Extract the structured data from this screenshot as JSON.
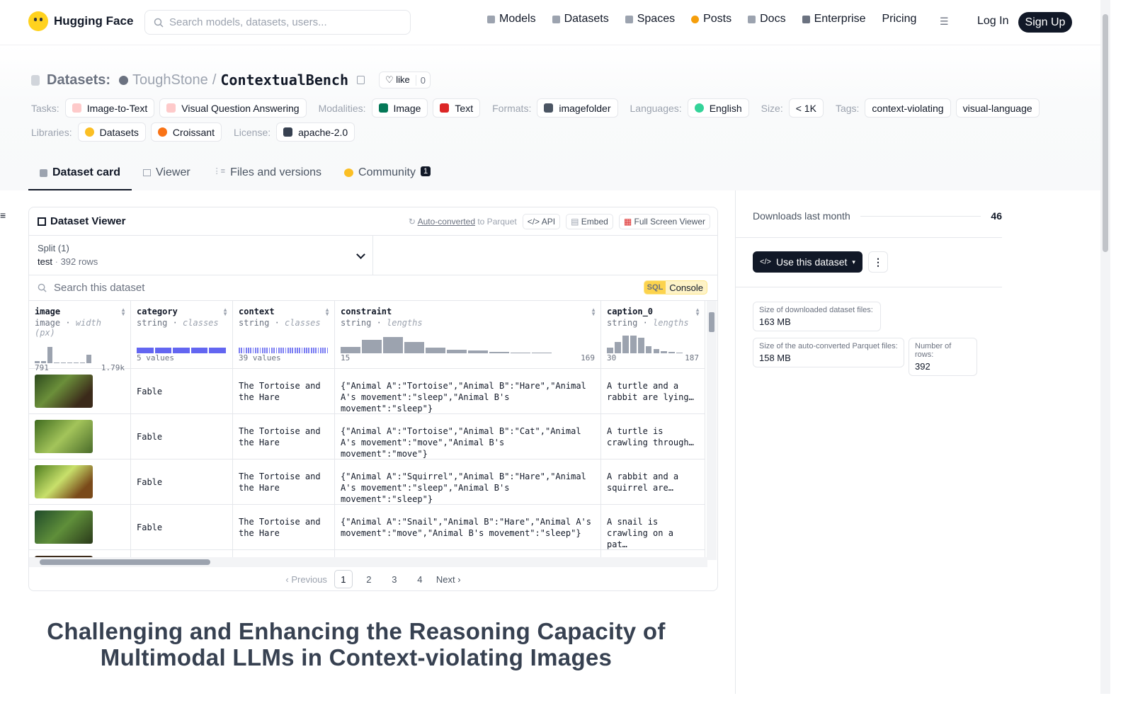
{
  "nav": {
    "brand": "Hugging Face",
    "search_placeholder": "Search models, datasets, users...",
    "links": [
      {
        "label": "Models",
        "icon": "cube-icon",
        "color": "#9ca3af"
      },
      {
        "label": "Datasets",
        "icon": "database-icon",
        "color": "#9ca3af"
      },
      {
        "label": "Spaces",
        "icon": "grid-icon",
        "color": "#9ca3af"
      },
      {
        "label": "Posts",
        "icon": "posts-icon",
        "color": "#f59e0b"
      },
      {
        "label": "Docs",
        "icon": "docs-icon",
        "color": "#9ca3af"
      },
      {
        "label": "Enterprise",
        "icon": "enterprise-icon",
        "color": "#6b7280"
      },
      {
        "label": "Pricing",
        "icon": "",
        "color": ""
      }
    ],
    "login": "Log In",
    "signup": "Sign Up"
  },
  "header": {
    "section": "Datasets:",
    "owner": "ToughStone",
    "separator": "/",
    "name": "ContextualBench",
    "like_label": "like",
    "like_count": "0",
    "tasks_label": "Tasks:",
    "tasks": [
      "Image-to-Text",
      "Visual Question Answering"
    ],
    "modalities_label": "Modalities:",
    "modalities": [
      "Image",
      "Text"
    ],
    "formats_label": "Formats:",
    "formats": [
      "imagefolder"
    ],
    "languages_label": "Languages:",
    "languages": [
      "English"
    ],
    "size_label": "Size:",
    "size": "< 1K",
    "tags_label": "Tags:",
    "tags": [
      "context-violating",
      "visual-language"
    ],
    "libraries_label": "Libraries:",
    "libraries": [
      "Datasets",
      "Croissant"
    ],
    "license_label": "License:",
    "license": "apache-2.0"
  },
  "tabs": [
    {
      "label": "Dataset card",
      "active": true
    },
    {
      "label": "Viewer"
    },
    {
      "label": "Files and versions"
    },
    {
      "label": "Community",
      "badge": "1"
    }
  ],
  "viewer": {
    "title": "Dataset Viewer",
    "auto_converted": "Auto-converted",
    "to_parquet": "to Parquet",
    "api": "API",
    "embed": "Embed",
    "fullscreen": "Full Screen Viewer",
    "split_label": "Split (1)",
    "split_name": "test",
    "split_rows": "392 rows",
    "search_placeholder": "Search this dataset",
    "sql_badge": "SQL",
    "sql_label": "Console",
    "columns": [
      {
        "name": "image",
        "type": "image",
        "stat": "width (px)",
        "min": "791",
        "max": "1.79k",
        "hist": [
          0.1,
          0.1,
          0.9,
          0,
          0,
          0,
          0,
          0,
          0.45
        ]
      },
      {
        "name": "category",
        "type": "string",
        "stat": "classes",
        "min": "5 values",
        "max": ""
      },
      {
        "name": "context",
        "type": "string",
        "stat": "classes",
        "min": "39 values",
        "max": ""
      },
      {
        "name": "constraint",
        "type": "string",
        "stat": "lengths",
        "min": "15",
        "max": "169",
        "hist": [
          0.35,
          0.75,
          0.9,
          0.6,
          0.3,
          0.2,
          0.15,
          0.08,
          0.04,
          0.04
        ]
      },
      {
        "name": "caption_0",
        "type": "string",
        "stat": "lengths",
        "min": "30",
        "max": "187",
        "hist": [
          0.3,
          0.6,
          0.95,
          0.95,
          0.85,
          0.4,
          0.25,
          0.1,
          0.08,
          0.04
        ]
      }
    ],
    "rows": [
      {
        "category": "Fable",
        "context": "The Tortoise and the Hare",
        "constraint": "{\"Animal A\":\"Tortoise\",\"Animal B\":\"Hare\",\"Animal A's movement\":\"sleep\",\"Animal B's movement\":\"sleep\"}",
        "caption": "A turtle and a rabbit are lying…"
      },
      {
        "category": "Fable",
        "context": "The Tortoise and the Hare",
        "constraint": "{\"Animal A\":\"Tortoise\",\"Animal B\":\"Cat\",\"Animal A's movement\":\"move\",\"Animal B's movement\":\"move\"}",
        "caption": "A turtle is crawling through…"
      },
      {
        "category": "Fable",
        "context": "The Tortoise and the Hare",
        "constraint": "{\"Animal A\":\"Squirrel\",\"Animal B\":\"Hare\",\"Animal A's movement\":\"sleep\",\"Animal B's movement\":\"sleep\"}",
        "caption": "A rabbit and a squirrel are…"
      },
      {
        "category": "Fable",
        "context": "The Tortoise and the Hare",
        "constraint": "{\"Animal A\":\"Snail\",\"Animal B\":\"Hare\",\"Animal A's movement\":\"move\",\"Animal B's movement\":\"sleep\"}",
        "caption": "A snail is crawling on a pat…"
      }
    ],
    "pager": {
      "previous": "Previous",
      "pages": [
        "1",
        "2",
        "3",
        "4"
      ],
      "current": "1",
      "next": "Next"
    }
  },
  "card_title": "Challenging and Enhancing the Reasoning Capacity of Multimodal LLMs in Context-violating Images",
  "sidebar": {
    "downloads_label": "Downloads last month",
    "downloads": "46",
    "use_button": "Use this dataset",
    "stats": [
      {
        "label": "Size of downloaded dataset files:",
        "value": "163 MB"
      },
      {
        "label": "Size of the auto-converted Parquet files:",
        "value": "158 MB"
      },
      {
        "label": "Number of rows:",
        "value": "392"
      }
    ]
  },
  "colors": {
    "accent": "#111827",
    "bar": "#6366f1",
    "hist": "#9ca3af"
  }
}
